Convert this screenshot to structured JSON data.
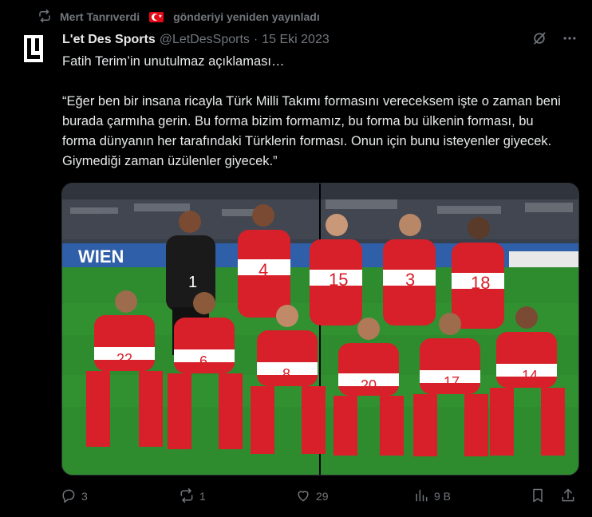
{
  "repost": {
    "user": "Mert Tanrıverdi",
    "text": "gönderiyi yeniden yayınladı",
    "icon": "repost-icon",
    "flag_icon": "turkey-flag-icon"
  },
  "tweet": {
    "author_name": "L'et Des Sports",
    "handle": "@LetDesSports",
    "separator": "·",
    "date": "15 Eki 2023",
    "text_line1": "Fatih Terim’in unutulmaz açıklaması…",
    "text_quote": "“Eğer ben bir insana ricayla Türk Milli Takımı formasını vereceksem işte o zaman beni burada çarmıha gerin. Bu forma bizim formamız, bu forma bu ülkenin forması, bu forma dünyanın her tarafındaki Türklerin forması. Onun için bunu isteyenler giyecek. Giymediği zaman üzülenler giyecek.”",
    "media_board_text": "WIEN",
    "shirt_numbers_back": [
      "1",
      "4",
      "15",
      "3",
      "18"
    ],
    "shirt_numbers_front": [
      "22",
      "6",
      "8",
      "20",
      "17",
      "14"
    ]
  },
  "actions": {
    "replies": "3",
    "reposts": "1",
    "likes": "29",
    "views": "9 B"
  },
  "colors": {
    "background": "#000000",
    "text_primary": "#e7e9ea",
    "text_secondary": "#71767b",
    "jersey_red": "#d8202a",
    "keeper": "#111111"
  }
}
